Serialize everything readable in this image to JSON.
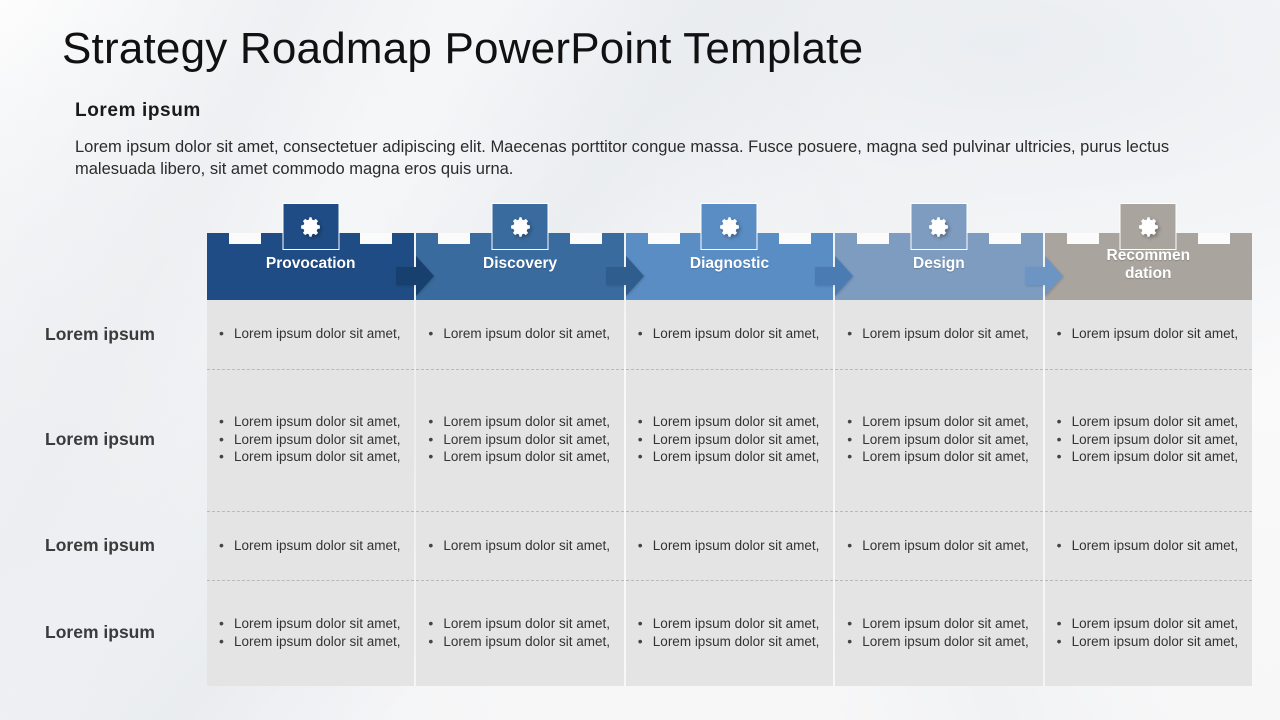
{
  "title": "Strategy Roadmap PowerPoint Template",
  "subtitle": "Lorem ipsum",
  "description": "Lorem ipsum dolor sit amet, consectetuer adipiscing elit. Maecenas porttitor congue massa. Fusce posuere, magna sed pulvinar ultricies, purus lectus malesuada libero, sit amet commodo magna eros quis urna.",
  "bullet_text": "Lorem ipsum dolor sit amet,",
  "icon_name": "gear-icon",
  "stages": [
    {
      "label": "Provocation",
      "color": "#1f4c85",
      "icon": "gear-icon"
    },
    {
      "label": "Discovery",
      "color": "#3a6b9e",
      "icon": "gear-icon"
    },
    {
      "label": "Diagnostic",
      "color": "#5a8dc4",
      "icon": "gear-icon"
    },
    {
      "label": "Design",
      "color": "#7e9cc0",
      "icon": "gear-icon"
    },
    {
      "label": "Recommendation",
      "color": "#aaa49f",
      "icon": "gear-icon",
      "label_line1": "Recommen",
      "label_line2": "dation"
    }
  ],
  "arrow_colors": [
    "#17406f",
    "#2f5d8d",
    "#4a7cb3",
    "#6d95c3"
  ],
  "row_labels": [
    "Lorem ipsum",
    "Lorem ipsum",
    "Lorem ipsum",
    "Lorem ipsum"
  ],
  "row_bullet_counts": [
    1,
    3,
    1,
    2
  ],
  "colors": {
    "page_background": "#fbfbfb",
    "cell_background": "#e4e4e4",
    "cell_divider": "#b9b9b9",
    "title_text": "#111111",
    "body_text": "#2b2b2b",
    "row_label_text": "#3b3b3b",
    "stage_label_text": "#ffffff"
  }
}
